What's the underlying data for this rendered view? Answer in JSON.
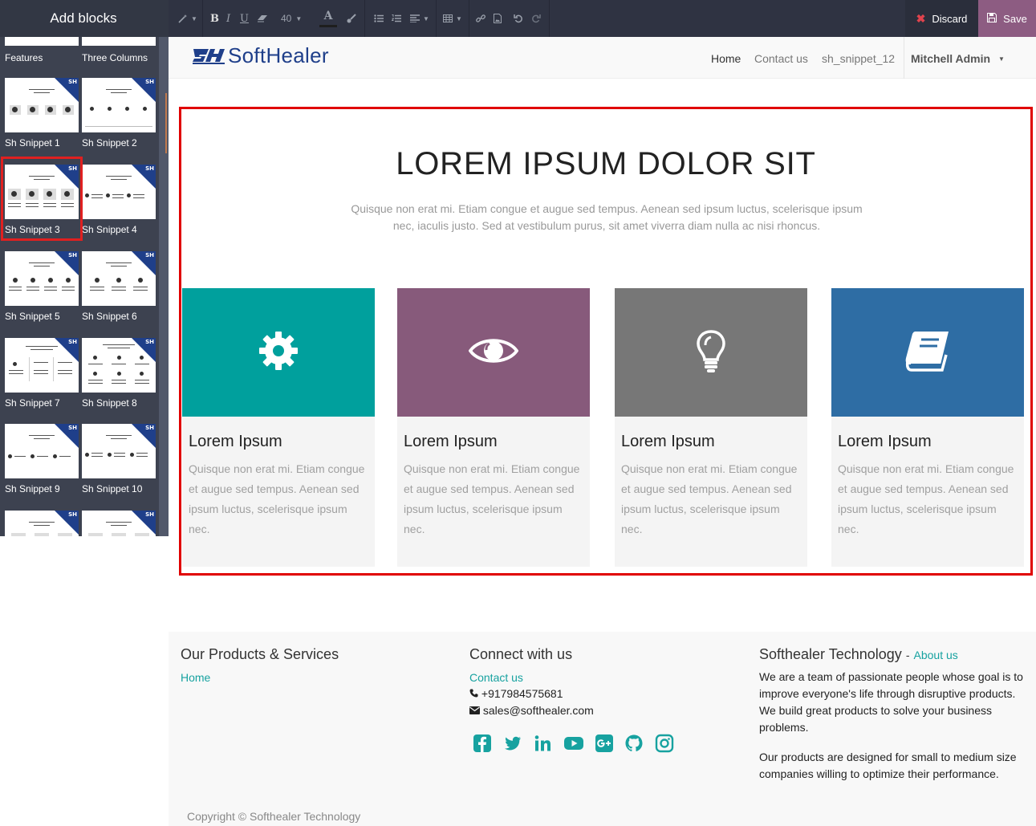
{
  "left_panel": {
    "title": "Add blocks",
    "blocks": [
      {
        "label": "Features"
      },
      {
        "label": "Three Columns"
      },
      {
        "label": "Sh Snippet 1"
      },
      {
        "label": "Sh Snippet 2"
      },
      {
        "label": "Sh Snippet 3",
        "selected": true
      },
      {
        "label": "Sh Snippet 4"
      },
      {
        "label": "Sh Snippet 5"
      },
      {
        "label": "Sh Snippet 6"
      },
      {
        "label": "Sh Snippet 7"
      },
      {
        "label": "Sh Snippet 8"
      },
      {
        "label": "Sh Snippet 9"
      },
      {
        "label": "Sh Snippet 10"
      }
    ],
    "corner_badge": "SH"
  },
  "toolbar": {
    "font_size": "40",
    "bold": "B",
    "italic": "I",
    "underline": "U",
    "font_color": "A",
    "discard_label": "Discard",
    "save_label": "Save"
  },
  "navbar": {
    "logo_text": "SoftHealer",
    "items": [
      "Home",
      "Contact us",
      "sh_snippet_12"
    ],
    "user": "Mitchell Admin"
  },
  "hero": {
    "title": "LOREM IPSUM DOLOR SIT",
    "subtitle": "Quisque non erat mi. Etiam congue et augue sed tempus. Aenean sed ipsum luctus, scelerisque ipsum nec, iaculis justo. Sed at vestibulum purus, sit amet viverra diam nulla ac nisi rhoncus.",
    "cards": [
      {
        "icon": "gear-icon",
        "color": "#00a09d",
        "title": "Lorem Ipsum",
        "text": "Quisque non erat mi. Etiam congue et augue sed tempus. Aenean sed ipsum luctus, scelerisque ipsum nec."
      },
      {
        "icon": "eye-icon",
        "color": "#875a7b",
        "title": "Lorem Ipsum",
        "text": "Quisque non erat mi. Etiam congue et augue sed tempus. Aenean sed ipsum luctus, scelerisque ipsum nec."
      },
      {
        "icon": "lightbulb-icon",
        "color": "#777777",
        "title": "Lorem Ipsum",
        "text": "Quisque non erat mi. Etiam congue et augue sed tempus. Aenean sed ipsum luctus, scelerisque ipsum nec."
      },
      {
        "icon": "book-icon",
        "color": "#2e6da4",
        "title": "Lorem Ipsum",
        "text": "Quisque non erat mi. Etiam congue et augue sed tempus. Aenean sed ipsum luctus, scelerisque ipsum nec."
      }
    ]
  },
  "footer": {
    "col1_title": "Our Products & Services",
    "col1_link": "Home",
    "col2_title": "Connect with us",
    "col2_link": "Contact us",
    "phone": "+917984575681",
    "email": "sales@softhealer.com",
    "social_icons": [
      "facebook-icon",
      "twitter-icon",
      "linkedin-icon",
      "youtube-icon",
      "google-plus-icon",
      "github-icon",
      "instagram-icon"
    ],
    "col3_title": "Softhealer Technology",
    "col3_title_sep": "-",
    "col3_link": "About us",
    "col3_p1": "We are a team of passionate people whose goal is to improve everyone's life through disruptive products. We build great products to solve your business problems.",
    "col3_p2": "Our products are designed for small to medium size companies willing to optimize their performance.",
    "copyright": "Copyright © Softhealer Technology"
  },
  "colors": {
    "accent": "#17a2a0",
    "save_bg": "#8d5c82",
    "selection_border": "#e00000"
  }
}
